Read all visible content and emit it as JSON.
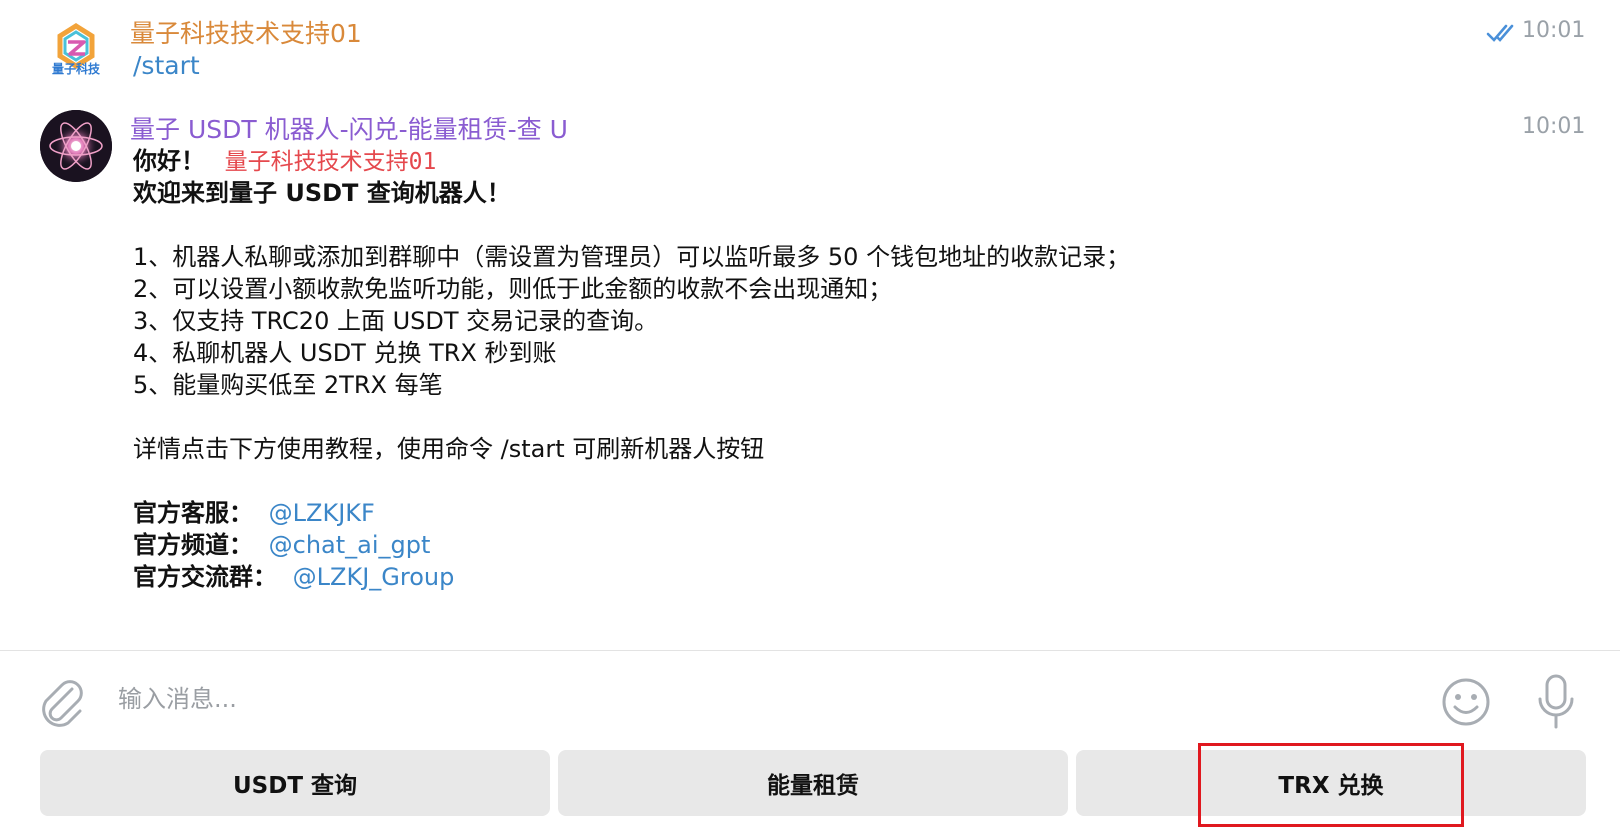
{
  "messages": [
    {
      "sender": "量子科技技术支持01",
      "sender_color": "#d9893a",
      "avatar_label": "量子科技",
      "time": "10:01",
      "status": "read",
      "text": "/start"
    },
    {
      "sender": "量子 USDT 机器人-闪兑-能量租赁-查 U",
      "sender_color": "#8a5cd1",
      "time": "10:01",
      "greeting": "你好！",
      "greeting_mention": "量子科技技术支持01",
      "welcome": "欢迎来到量子 USDT 查询机器人！",
      "items": [
        "1、机器人私聊或添加到群聊中（需设置为管理员）可以监听最多 50 个钱包地址的收款记录；",
        "2、可以设置小额收款免监听功能，则低于此金额的收款不会出现通知；",
        "3、仅支持 TRC20 上面 USDT 交易记录的查询。",
        "4、私聊机器人 USDT 兑换 TRX 秒到账",
        "5、能量购买低至 2TRX 每笔"
      ],
      "details": "详情点击下方使用教程，使用命令 /start 可刷新机器人按钮",
      "contacts": [
        {
          "label": "官方客服：",
          "handle": "@LZKJKF"
        },
        {
          "label": "官方频道：",
          "handle": "@chat_ai_gpt"
        },
        {
          "label": "官方交流群：",
          "handle": "@LZKJ_Group"
        }
      ]
    }
  ],
  "composer": {
    "placeholder": "输入消息...",
    "icons": [
      "paperclip-icon",
      "emoji-icon",
      "microphone-icon"
    ]
  },
  "keyboard": {
    "buttons": [
      "USDT 查询",
      "能量租赁",
      "TRX 兑换"
    ]
  },
  "colors": {
    "link": "#3b86c8",
    "mention": "#e5484d",
    "button_bg": "#e8e8e8",
    "highlight": "#e0181f"
  }
}
